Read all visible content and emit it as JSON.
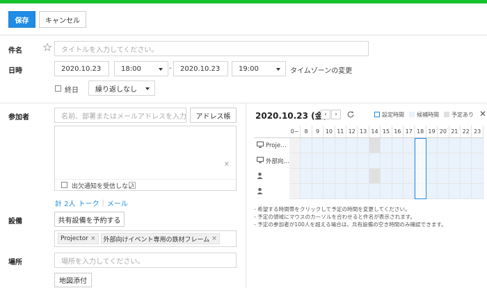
{
  "toolbar": {
    "save_label": "保存",
    "cancel_label": "キャンセル",
    "accent_color": "#1f8ce6",
    "topbar_color": "#14c22c"
  },
  "subject": {
    "label": "件名",
    "placeholder": "タイトルを入力してください。"
  },
  "datetime": {
    "label": "日時",
    "start_date": "2020.10.23",
    "start_time": "18:00",
    "separator": "-",
    "end_date": "2020.10.23",
    "end_time": "19:00",
    "timezone_link": "タイムゾーンの変更",
    "all_day_label": "終日",
    "repeat_value": "繰り返しなし"
  },
  "participants": {
    "label": "参加者",
    "search_placeholder": "名前、部署またはメールアドレスを入力…",
    "address_book_button": "アドレス帳",
    "remove_all": "×",
    "no_reply_label": "出欠通知を受信しない",
    "help": "?",
    "count_label": "計 2人",
    "talk_link": "トーク",
    "divider": "|",
    "mail_link": "メール"
  },
  "equipment": {
    "label": "設備",
    "reserve_button": "共有設備を予約する",
    "tags": [
      {
        "name": "Projector",
        "remove": "×"
      },
      {
        "name": "外部向けイベント専用の鉄材フレーム",
        "remove": "×"
      }
    ]
  },
  "place": {
    "label": "場所",
    "placeholder": "場所を入力してください。",
    "map_button": "地図添付"
  },
  "calendar": {
    "date_title": "2020.10.23 (金)",
    "prev": "‹",
    "next": "›",
    "refresh_icon": "refresh-icon",
    "close": "✕",
    "legend": [
      {
        "label": "設定時間",
        "color": "#ffffff",
        "border": "#1f8ce6"
      },
      {
        "label": "候補時間",
        "color": "#eaf2fb",
        "border": "#eaf2fb"
      },
      {
        "label": "予定あり",
        "color": "#e0e0e0",
        "border": "#e0e0e0"
      }
    ],
    "hours": [
      "0~",
      "8",
      "9",
      "10",
      "11",
      "12",
      "13",
      "14",
      "15",
      "16",
      "17",
      "18",
      "19",
      "20",
      "21",
      "22",
      "23"
    ],
    "rows": [
      {
        "icon": "monitor-icon",
        "label": "Proje…"
      },
      {
        "icon": "monitor-icon",
        "label": "外部向…"
      },
      {
        "icon": "person-icon",
        "label": ""
      },
      {
        "icon": "person-icon",
        "label": ""
      }
    ],
    "busy": [
      {
        "row": 0,
        "hour": "14"
      },
      {
        "row": 2,
        "hour": "14"
      }
    ],
    "selected_hour": "18",
    "notes": [
      "- 希望する時間帯をクリックして予定の時間を変更してください。",
      "- 予定の領域にマウスのカーソルを合わせると件名が表示されます。",
      "- 予定の参加者が100人を超える場合は、共有設備の空き時間のみ確認できます。"
    ]
  }
}
